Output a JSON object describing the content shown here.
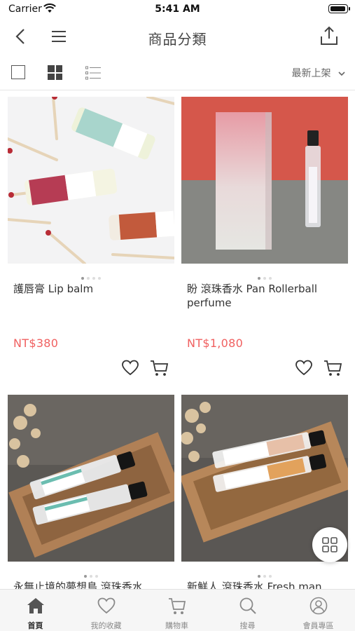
{
  "status_bar": {
    "carrier": "Carrier",
    "time": "5:41 AM"
  },
  "nav": {
    "title": "商品分類"
  },
  "toolbar": {
    "sort_label": "最新上架"
  },
  "products": [
    {
      "name": "護唇膏 Lip balm",
      "price": "NT$380"
    },
    {
      "name": "盼 滾珠香水 Pan Rollerball perfume",
      "price": "NT$1,080"
    },
    {
      "name": "永無止境的夢想島 滾珠香水",
      "price": ""
    },
    {
      "name": "新鮮人 滾珠香水 Fresh man",
      "price": ""
    }
  ],
  "tabs": [
    {
      "label": "首頁",
      "icon": "home-icon"
    },
    {
      "label": "我的收藏",
      "icon": "heart-icon"
    },
    {
      "label": "購物車",
      "icon": "cart-icon"
    },
    {
      "label": "搜尋",
      "icon": "search-icon"
    },
    {
      "label": "會員專區",
      "icon": "user-icon"
    }
  ],
  "colors": {
    "price": "#f06060",
    "active_tab": "#333333",
    "inactive_tab": "#8a8a8a"
  }
}
